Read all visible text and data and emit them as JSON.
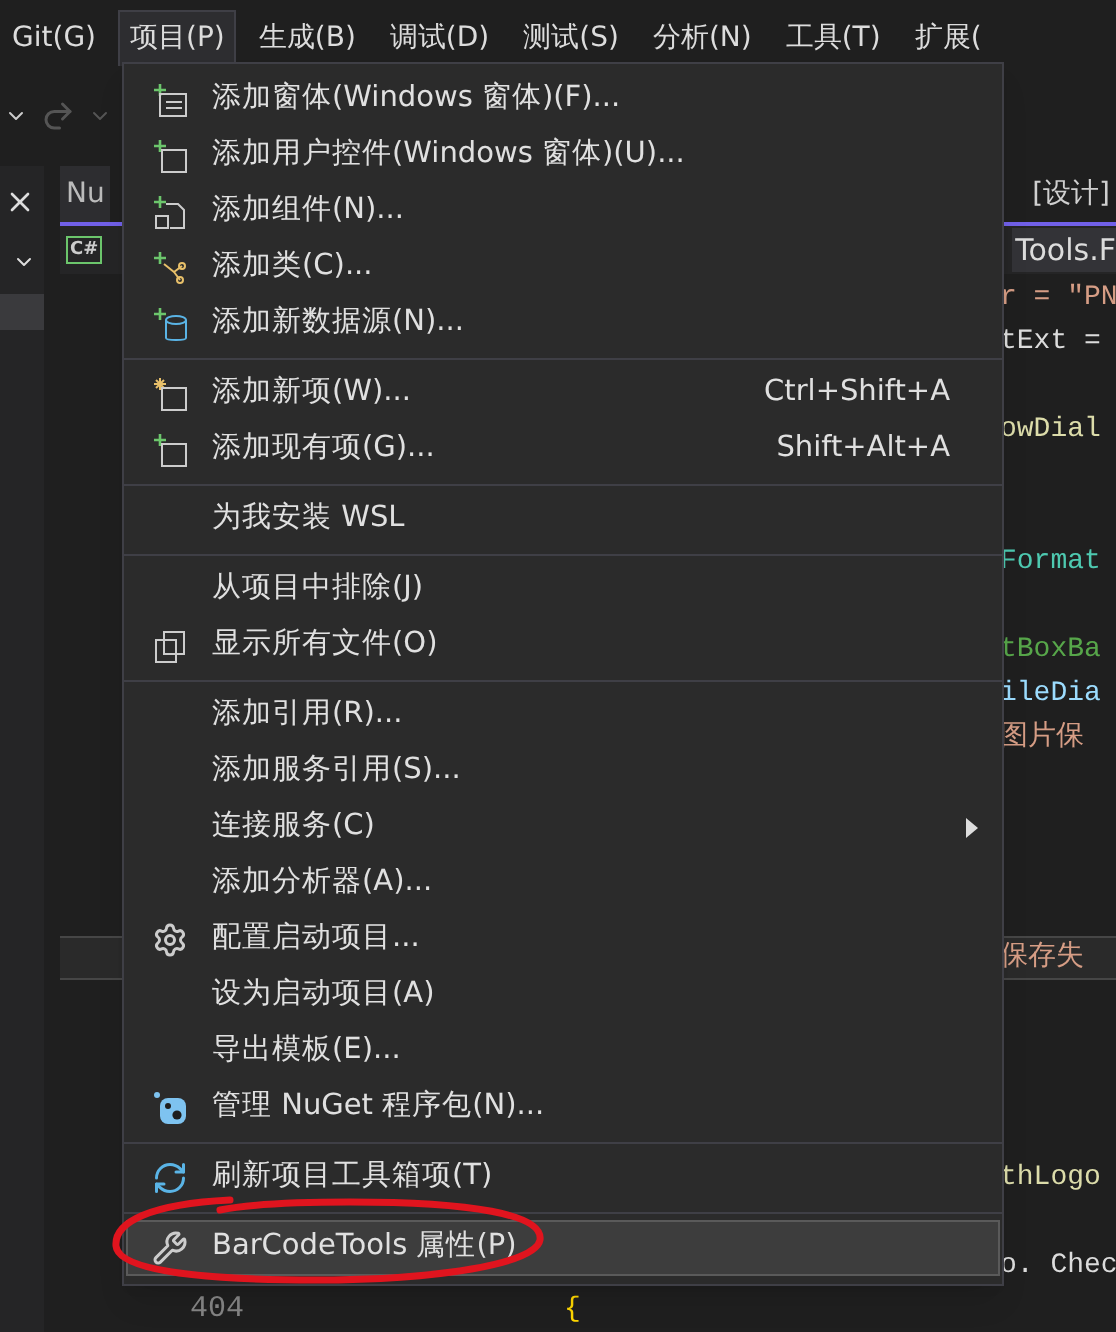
{
  "menubar": [
    {
      "label": "Git(G)",
      "selected": false
    },
    {
      "label": "项目(P)",
      "selected": true
    },
    {
      "label": "生成(B)",
      "selected": false
    },
    {
      "label": "调试(D)",
      "selected": false
    },
    {
      "label": "测试(S)",
      "selected": false
    },
    {
      "label": "分析(N)",
      "selected": false
    },
    {
      "label": "工具(T)",
      "selected": false
    },
    {
      "label": "扩展(",
      "selected": false
    }
  ],
  "document_tabs": [
    {
      "label": "Nu",
      "selected": false
    },
    {
      "label": "[设计]",
      "selected": true
    }
  ],
  "file_bar": {
    "language_badge": "C#",
    "right_text": "Tools.F"
  },
  "code_fragments": [
    {
      "text": "r = \"PN",
      "kind": "string"
    },
    {
      "text": "tExt =",
      "kind": "plain"
    },
    {
      "text": "owDial",
      "kind": "method"
    },
    {
      "text": "Format",
      "kind": "type"
    },
    {
      "text": "tBoxBa",
      "kind": "control"
    },
    {
      "text": "ileDia",
      "kind": "field"
    },
    {
      "text": "图片保",
      "kind": "string"
    },
    {
      "text": "保存失",
      "kind": "string"
    },
    {
      "text": "thLogo",
      "kind": "method"
    },
    {
      "text": "o. Chec",
      "kind": "plain"
    }
  ],
  "bottom_line": {
    "line_number": "404",
    "brace": "{"
  },
  "menu": {
    "groups": [
      [
        {
          "label": "添加窗体(Windows 窗体)(F)...",
          "kind": "form",
          "submenu": false,
          "selected": false
        },
        {
          "label": "添加用户控件(Windows 窗体)(U)...",
          "kind": "control",
          "submenu": false,
          "selected": false
        },
        {
          "label": "添加组件(N)...",
          "kind": "component",
          "submenu": false,
          "selected": false
        },
        {
          "label": "添加类(C)...",
          "kind": "class",
          "submenu": false,
          "selected": false
        },
        {
          "label": "添加新数据源(N)...",
          "kind": "datasource",
          "submenu": false,
          "selected": false
        }
      ],
      [
        {
          "label": "添加新项(W)...",
          "shortcut": "Ctrl+Shift+A",
          "kind": "newitem",
          "submenu": false,
          "selected": false
        },
        {
          "label": "添加现有项(G)...",
          "shortcut": "Shift+Alt+A",
          "kind": "existing",
          "submenu": false,
          "selected": false
        }
      ],
      [
        {
          "label": "为我安装 WSL",
          "kind": "plain",
          "submenu": false,
          "selected": false
        }
      ],
      [
        {
          "label": "从项目中排除(J)",
          "kind": "plain",
          "submenu": false,
          "selected": false
        },
        {
          "label": "显示所有文件(O)",
          "kind": "files",
          "submenu": false,
          "selected": false
        }
      ],
      [
        {
          "label": "添加引用(R)...",
          "kind": "plain",
          "submenu": false,
          "selected": false
        },
        {
          "label": "添加服务引用(S)...",
          "kind": "plain",
          "submenu": false,
          "selected": false
        },
        {
          "label": "连接服务(C)",
          "kind": "plain",
          "submenu": true,
          "selected": false
        },
        {
          "label": "添加分析器(A)...",
          "kind": "plain",
          "submenu": false,
          "selected": false
        },
        {
          "label": "配置启动项目...",
          "kind": "gear",
          "submenu": false,
          "selected": false
        },
        {
          "label": "设为启动项目(A)",
          "kind": "plain",
          "submenu": false,
          "selected": false
        },
        {
          "label": "导出模板(E)...",
          "kind": "plain",
          "submenu": false,
          "selected": false
        },
        {
          "label": "管理 NuGet 程序包(N)...",
          "kind": "nuget",
          "submenu": false,
          "selected": false
        }
      ],
      [
        {
          "label": "刷新项目工具箱项(T)",
          "kind": "refresh",
          "submenu": false,
          "selected": false
        }
      ],
      [
        {
          "label": "BarCodeTools 属性(P)",
          "kind": "wrench",
          "submenu": false,
          "selected": true
        }
      ]
    ]
  }
}
